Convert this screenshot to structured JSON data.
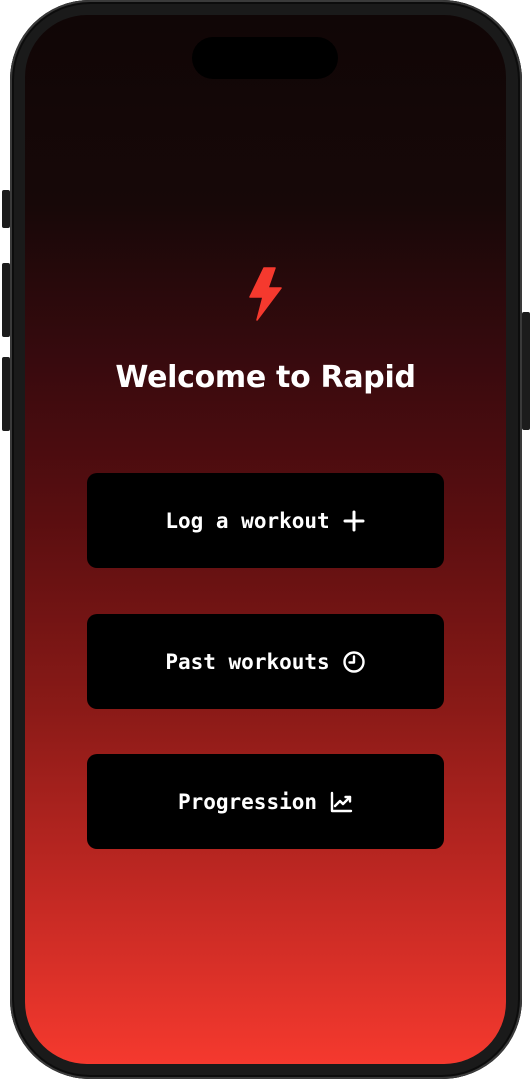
{
  "app": {
    "title": "Welcome to Rapid",
    "logo_icon": "lightning-bolt-icon",
    "accent_color": "#f5392e",
    "background_gradient": [
      "#100606",
      "#5a0e10",
      "#f5392e"
    ]
  },
  "menu": {
    "items": [
      {
        "label": "Log a workout",
        "icon": "plus-icon"
      },
      {
        "label": "Past workouts",
        "icon": "clock-icon"
      },
      {
        "label": "Progression",
        "icon": "chart-icon"
      }
    ]
  }
}
